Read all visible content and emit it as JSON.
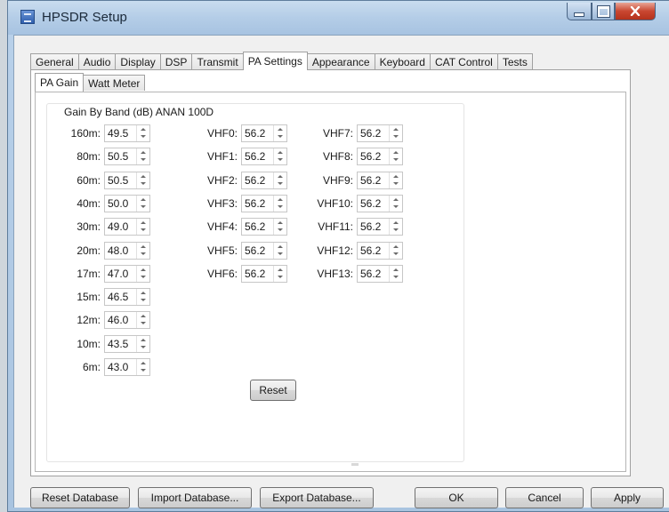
{
  "window": {
    "title": "HPSDR Setup"
  },
  "tabs": [
    "General",
    "Audio",
    "Display",
    "DSP",
    "Transmit",
    "PA Settings",
    "Appearance",
    "Keyboard",
    "CAT Control",
    "Tests"
  ],
  "active_tab": "PA Settings",
  "subtabs": [
    "PA Gain",
    "Watt Meter"
  ],
  "active_subtab": "PA Gain",
  "gain_group": {
    "title": "Gain By Band (dB) ANAN 100D",
    "col1": [
      {
        "label": "160m:",
        "value": "49.5"
      },
      {
        "label": "80m:",
        "value": "50.5"
      },
      {
        "label": "60m:",
        "value": "50.5"
      },
      {
        "label": "40m:",
        "value": "50.0"
      },
      {
        "label": "30m:",
        "value": "49.0"
      },
      {
        "label": "20m:",
        "value": "48.0"
      },
      {
        "label": "17m:",
        "value": "47.0"
      },
      {
        "label": "15m:",
        "value": "46.5"
      },
      {
        "label": "12m:",
        "value": "46.0"
      },
      {
        "label": "10m:",
        "value": "43.5"
      },
      {
        "label": "6m:",
        "value": "43.0"
      }
    ],
    "col2": [
      {
        "label": "VHF0:",
        "value": "56.2"
      },
      {
        "label": "VHF1:",
        "value": "56.2"
      },
      {
        "label": "VHF2:",
        "value": "56.2"
      },
      {
        "label": "VHF3:",
        "value": "56.2"
      },
      {
        "label": "VHF4:",
        "value": "56.2"
      },
      {
        "label": "VHF5:",
        "value": "56.2"
      },
      {
        "label": "VHF6:",
        "value": "56.2"
      }
    ],
    "col3": [
      {
        "label": "VHF7:",
        "value": "56.2"
      },
      {
        "label": "VHF8:",
        "value": "56.2"
      },
      {
        "label": "VHF9:",
        "value": "56.2"
      },
      {
        "label": "VHF10:",
        "value": "56.2"
      },
      {
        "label": "VHF11:",
        "value": "56.2"
      },
      {
        "label": "VHF12:",
        "value": "56.2"
      },
      {
        "label": "VHF13:",
        "value": "56.2"
      }
    ],
    "reset_label": "Reset"
  },
  "footer": {
    "reset_db": "Reset Database",
    "import_db": "Import Database...",
    "export_db": "Export Database...",
    "ok": "OK",
    "cancel": "Cancel",
    "apply": "Apply"
  }
}
